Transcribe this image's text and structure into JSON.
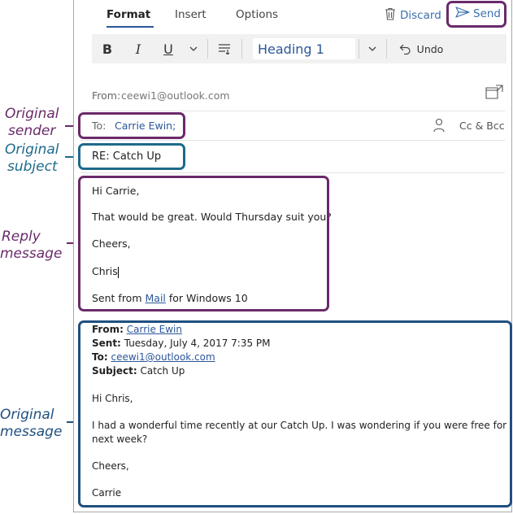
{
  "tabs": {
    "format": "Format",
    "insert": "Insert",
    "options": "Options"
  },
  "actions": {
    "discard": "Discard",
    "send": "Send"
  },
  "toolbar": {
    "bold": "B",
    "italic": "I",
    "underline": "U",
    "style_value": "Heading 1",
    "undo": "Undo"
  },
  "header": {
    "from_label": "From:",
    "from_value": "ceewi1@outlook.com",
    "to_label": "To:",
    "to_value": "Carrie Ewin;",
    "cc_bcc": "Cc & Bcc",
    "subject": "RE: Catch Up"
  },
  "reply": {
    "greeting": "Hi Carrie,",
    "line1": "That would be great.  Would Thursday suit you?",
    "closing": "Cheers,",
    "name": "Chris",
    "sig_prefix": "Sent from ",
    "sig_link": "Mail",
    "sig_suffix": " for Windows 10"
  },
  "original": {
    "from_label": "From:",
    "from_value": "Carrie Ewin",
    "sent_label": "Sent:",
    "sent_value": "Tuesday, July 4, 2017 7:35 PM",
    "to_label": "To:",
    "to_value": "ceewi1@outlook.com",
    "subject_label": "Subject:",
    "subject_value": "Catch Up",
    "greeting": "Hi Chris,",
    "para1": "I had a wonderful time recently at our Catch Up. I was wondering if you were free for lunch",
    "para2": "next week?",
    "closing": "Cheers,",
    "name": "Carrie"
  },
  "callouts": {
    "sender_1": "Original",
    "sender_2": "sender",
    "subject_1": "Original",
    "subject_2": "subject",
    "reply_1": "Reply",
    "reply_2": "message",
    "original_1": "Original",
    "original_2": "message"
  },
  "colors": {
    "purple": "#6a2a6a",
    "teal": "#1e6a8a",
    "navy": "#1f4f7f",
    "accent": "#2b579a"
  },
  "icons": {
    "discard": "trash-icon",
    "send": "send-icon",
    "paragraph": "paragraph-format-icon",
    "undo": "undo-arrow-icon",
    "popout": "popout-window-icon",
    "person": "person-icon"
  }
}
